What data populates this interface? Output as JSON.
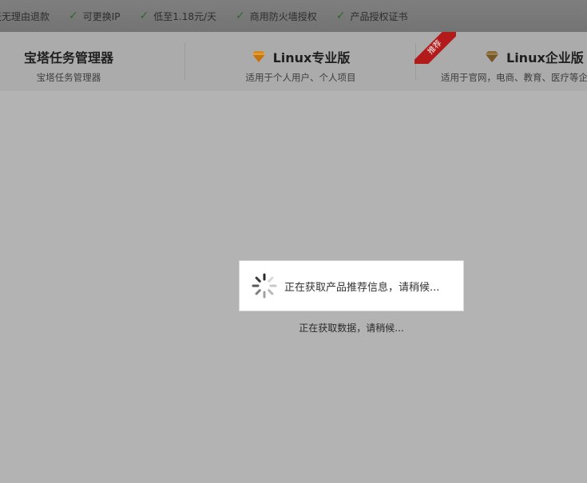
{
  "features": [
    {
      "label": "天无理由退款",
      "icon": "check-icon"
    },
    {
      "label": "可更换IP",
      "icon": "check-icon"
    },
    {
      "label": "低至1.18元/天",
      "icon": "check-icon"
    },
    {
      "label": "商用防火墙授权",
      "icon": "check-icon"
    },
    {
      "label": "产品授权证书",
      "icon": "check-icon"
    }
  ],
  "products": [
    {
      "title": "宝塔任务管理器",
      "subtitle": "宝塔任务管理器"
    },
    {
      "title": "Linux专业版",
      "subtitle": "适用于个人用户、个人项目",
      "icon": "gem-icon",
      "icon_color": "#d98a1a"
    },
    {
      "title": "Linux企业版",
      "subtitle": "适用于官网，电商、教育、医疗等企",
      "icon": "gem-icon",
      "icon_color": "#8a6d3b",
      "badge": "推荐"
    }
  ],
  "loading": {
    "message": "正在获取产品推荐信息，请稍候...",
    "status": "正在获取数据，请稍候..."
  },
  "colors": {
    "overlay_bg": "#b3b3b3",
    "badge_red": "#b31a1a",
    "check_green": "#256d2a"
  }
}
